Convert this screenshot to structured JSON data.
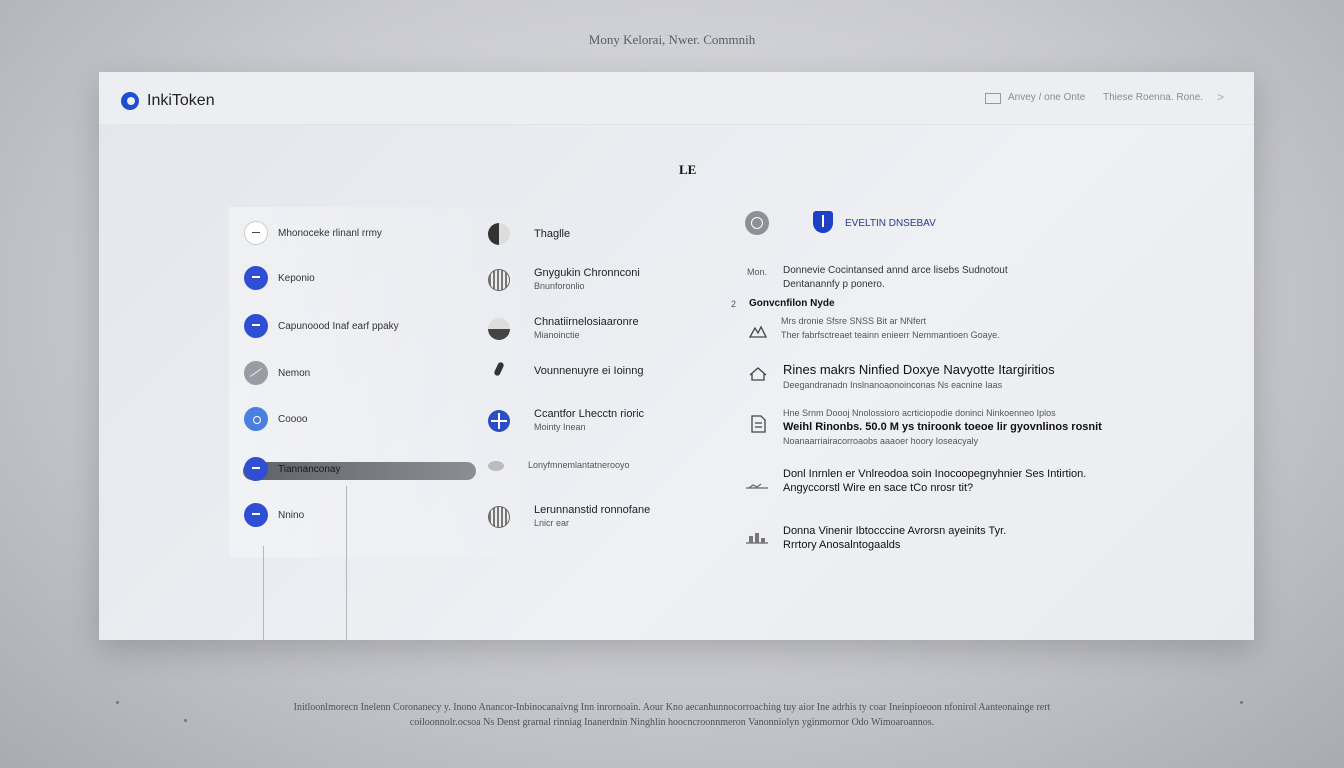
{
  "top_caption": "Mony Kelorai, Nwer. Commnih",
  "header": {
    "app_name": "InkiToken",
    "link1": "Anvey / one Onte",
    "link2": "Thiese Roenna. Rone.",
    "arrow": ">"
  },
  "center_mark": "LE",
  "menu_left": [
    {
      "icon": "minus-circle-icon",
      "label": "Mhonoceke rlinanl rrmy"
    },
    {
      "icon": "user-circle-icon",
      "label": "Keponio"
    },
    {
      "icon": "user-circle-icon",
      "label": "Capunoood Inaf earf ppaky"
    },
    {
      "icon": "slash-circle-icon",
      "label": "Nemon"
    },
    {
      "icon": "ring-circle-icon",
      "label": "Coooo"
    },
    {
      "icon": "user-circle-icon",
      "label": "Tiannanconay",
      "active": true
    },
    {
      "icon": "user-circle-icon",
      "label": "Nnino"
    }
  ],
  "menu_mid": [
    {
      "icon": "contrast-icon",
      "title": "Thaglle",
      "sub": ""
    },
    {
      "icon": "barcode-icon",
      "title": "Gnygukin Chronnconi",
      "sub": "Bnunforonlio"
    },
    {
      "icon": "half-moon-icon",
      "title": "Chnatiirnelosiaaronre",
      "sub": "Mianoinctie"
    },
    {
      "icon": "pin-icon",
      "title": "Vounnenuyre ei Ioinng",
      "sub": ""
    },
    {
      "icon": "plus-circle-icon",
      "title": "Ccantfor Lhecctn rioric",
      "sub": "Mointy Inean"
    },
    {
      "icon": "bean-icon",
      "title": "Lonyfmnemlantatnerooyo",
      "sub": ""
    },
    {
      "icon": "striped-circle-icon",
      "title": "Lerunnanstid ronnofane",
      "sub": "Lnicr ear"
    }
  ],
  "right_panel": {
    "title": "EVELTIN DNSEBAV",
    "items": [
      {
        "icon": "mon-label",
        "lead": "Mon.",
        "line1": "Donnevie Cocintansed annd arce lisebs Sudnotout",
        "line2": "Dentanannfy p ponero."
      },
      {
        "icon": "number-label",
        "lead": "2",
        "line1": "Gonvcnfilon Nyde",
        "line2": ""
      },
      {
        "icon": "mountain-icon",
        "lead": "",
        "line1": "Mrs dronie Sfsre SNSS Bit ar NNfert",
        "line2": "Ther fabrfsctreaet teainn enieerr Nemmantioen Goaye."
      },
      {
        "icon": "home-icon",
        "lead": "",
        "line1": "Rines makrs Ninfied Doxye Navyotte Itargiritios",
        "line2": "Deegandranadn Inslnanoaonoinconas Ns eacnine Iaas"
      },
      {
        "icon": "document-icon",
        "lead": "",
        "line1": "Hne Srnm Doooj Nnolossioro acrticiopodie doninci Ninkoenneo Iplos",
        "line2": "Weihl Rinonbs. 50.0 M ys tniroonk toeoe lir gyovnlinos rosnit",
        "line3": "Noanaarriairacorroaobs aaaoer hoory Ioseacyaly"
      },
      {
        "icon": "chart-icon",
        "lead": "",
        "line1": "Donl Inrnlen er Vnlreodoa soin Inocoopegnyhnier Ses Intirtion.",
        "line2": "Angyccorstl Wire en sace tCo nrosr tit?"
      },
      {
        "icon": "chart-bar-icon",
        "lead": "",
        "line1": "Donna Vinenir Ibtocccine Avrorsn ayeinits Tyr.",
        "line2": "Rrrtory Anosalntogaalds"
      }
    ]
  },
  "footer": {
    "line1": "Initloonlmorecn Inelenn Coronanecy y. Inono Anancor-Inbinocanaivng Inn inrornoain. Aour Kno aecanhunnocorroaching tuy aior Ine adrhis ty coar Ineinpioeoon nfonirol Aanteonainge rert",
    "line2": "coiloonnolr.ocsoa Ns Denst grarnal rinniag Inanerdnin Ninghlin hoocncroonnmeron Vanonniolyn yginmornor Odo Wimoaroannos."
  }
}
